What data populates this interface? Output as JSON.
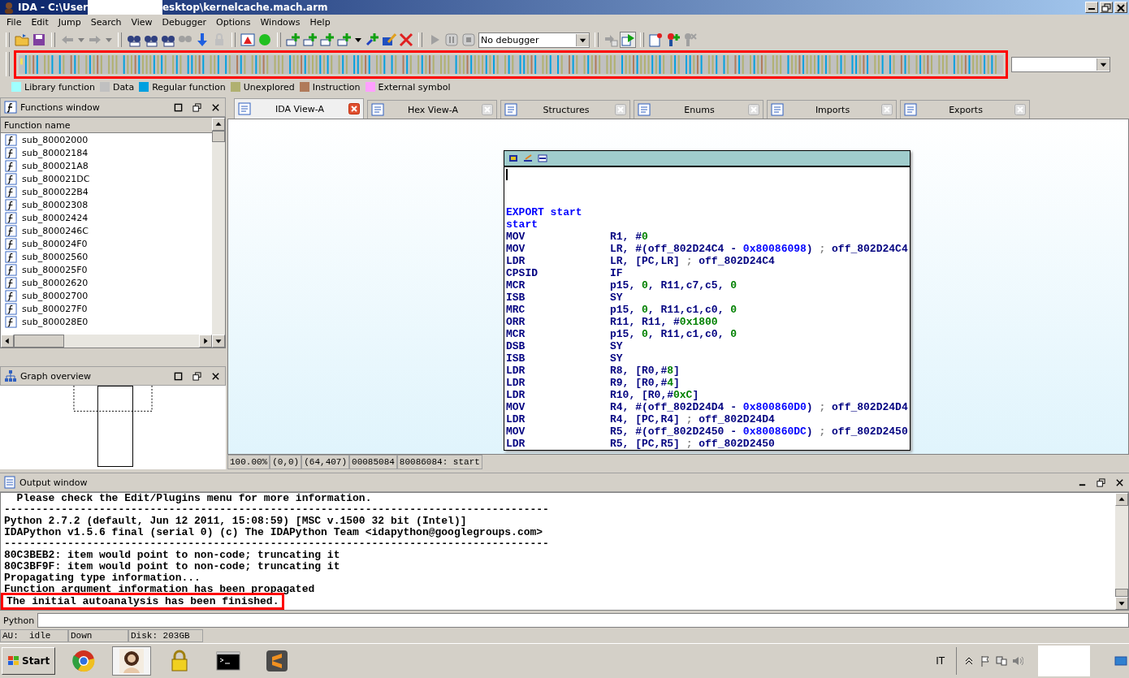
{
  "window": {
    "title_before": "IDA - C:\\User",
    "title_after": "esktop\\kernelcache.mach.arm"
  },
  "menu": [
    "File",
    "Edit",
    "Jump",
    "Search",
    "View",
    "Debugger",
    "Options",
    "Windows",
    "Help"
  ],
  "debugger_select": {
    "value": "No debugger"
  },
  "navigation_band": {
    "highlighted": true
  },
  "legend": [
    {
      "label": "Library function",
      "color": "#a0ffff"
    },
    {
      "label": "Data",
      "color": "#c0c0c0"
    },
    {
      "label": "Regular function",
      "color": "#00a0e0"
    },
    {
      "label": "Unexplored",
      "color": "#b0b070"
    },
    {
      "label": "Instruction",
      "color": "#b07a5a"
    },
    {
      "label": "External symbol",
      "color": "#ffa0ff"
    }
  ],
  "functions_window": {
    "title": "Functions window",
    "column": "Function name",
    "rows": [
      "sub_80002000",
      "sub_80002184",
      "sub_800021A8",
      "sub_800021DC",
      "sub_800022B4",
      "sub_80002308",
      "sub_80002424",
      "sub_8000246C",
      "sub_800024F0",
      "sub_80002560",
      "sub_800025F0",
      "sub_80002620",
      "sub_80002700",
      "sub_800027F0",
      "sub_800028E0"
    ]
  },
  "graph_overview": {
    "title": "Graph overview"
  },
  "tabs": [
    {
      "label": "IDA View-A",
      "selected": true
    },
    {
      "label": "Hex View-A",
      "selected": false
    },
    {
      "label": "Structures",
      "selected": false
    },
    {
      "label": "Enums",
      "selected": false
    },
    {
      "label": "Imports",
      "selected": false
    },
    {
      "label": "Exports",
      "selected": false
    }
  ],
  "disassembly": [
    {
      "kind": "label",
      "text": "EXPORT start"
    },
    {
      "kind": "label",
      "text": "start"
    },
    {
      "kind": "insn",
      "mnemonic": "MOV",
      "operands": [
        {
          "kind": "reg",
          "text": "R1, #"
        },
        {
          "kind": "num",
          "text": "0"
        }
      ]
    },
    {
      "kind": "insn",
      "mnemonic": "MOV",
      "operands": [
        {
          "kind": "reg",
          "text": "LR, #(off_802D24C4 - "
        },
        {
          "kind": "addr",
          "text": "0x80086098"
        },
        {
          "kind": "reg",
          "text": ") "
        },
        {
          "kind": "cmt",
          "text": "; "
        },
        {
          "kind": "reg",
          "text": "off_802D24C4"
        }
      ]
    },
    {
      "kind": "insn",
      "mnemonic": "LDR",
      "operands": [
        {
          "kind": "reg",
          "text": "LR, [PC,LR] "
        },
        {
          "kind": "cmt",
          "text": "; "
        },
        {
          "kind": "reg",
          "text": "off_802D24C4"
        }
      ]
    },
    {
      "kind": "insn",
      "mnemonic": "CPSID",
      "operands": [
        {
          "kind": "reg",
          "text": "IF"
        }
      ]
    },
    {
      "kind": "insn",
      "mnemonic": "MCR",
      "operands": [
        {
          "kind": "reg",
          "text": "p15, "
        },
        {
          "kind": "num",
          "text": "0"
        },
        {
          "kind": "reg",
          "text": ", R11,c7,c5, "
        },
        {
          "kind": "num",
          "text": "0"
        }
      ]
    },
    {
      "kind": "insn",
      "mnemonic": "ISB",
      "operands": [
        {
          "kind": "reg",
          "text": "SY"
        }
      ]
    },
    {
      "kind": "insn",
      "mnemonic": "MRC",
      "operands": [
        {
          "kind": "reg",
          "text": "p15, "
        },
        {
          "kind": "num",
          "text": "0"
        },
        {
          "kind": "reg",
          "text": ", R11,c1,c0, "
        },
        {
          "kind": "num",
          "text": "0"
        }
      ]
    },
    {
      "kind": "insn",
      "mnemonic": "ORR",
      "operands": [
        {
          "kind": "reg",
          "text": "R11, R11, #"
        },
        {
          "kind": "num",
          "text": "0x1800"
        }
      ]
    },
    {
      "kind": "insn",
      "mnemonic": "MCR",
      "operands": [
        {
          "kind": "reg",
          "text": "p15, "
        },
        {
          "kind": "num",
          "text": "0"
        },
        {
          "kind": "reg",
          "text": ", R11,c1,c0, "
        },
        {
          "kind": "num",
          "text": "0"
        }
      ]
    },
    {
      "kind": "insn",
      "mnemonic": "DSB",
      "operands": [
        {
          "kind": "reg",
          "text": "SY"
        }
      ]
    },
    {
      "kind": "insn",
      "mnemonic": "ISB",
      "operands": [
        {
          "kind": "reg",
          "text": "SY"
        }
      ]
    },
    {
      "kind": "insn",
      "mnemonic": "LDR",
      "operands": [
        {
          "kind": "reg",
          "text": "R8, [R0,#"
        },
        {
          "kind": "num",
          "text": "8"
        },
        {
          "kind": "reg",
          "text": "]"
        }
      ]
    },
    {
      "kind": "insn",
      "mnemonic": "LDR",
      "operands": [
        {
          "kind": "reg",
          "text": "R9, [R0,#"
        },
        {
          "kind": "num",
          "text": "4"
        },
        {
          "kind": "reg",
          "text": "]"
        }
      ]
    },
    {
      "kind": "insn",
      "mnemonic": "LDR",
      "operands": [
        {
          "kind": "reg",
          "text": "R10, [R0,#"
        },
        {
          "kind": "num",
          "text": "0xC"
        },
        {
          "kind": "reg",
          "text": "]"
        }
      ]
    },
    {
      "kind": "insn",
      "mnemonic": "MOV",
      "operands": [
        {
          "kind": "reg",
          "text": "R4, #(off_802D24D4 - "
        },
        {
          "kind": "addr",
          "text": "0x800860D0"
        },
        {
          "kind": "reg",
          "text": ") "
        },
        {
          "kind": "cmt",
          "text": "; "
        },
        {
          "kind": "reg",
          "text": "off_802D24D4"
        }
      ]
    },
    {
      "kind": "insn",
      "mnemonic": "LDR",
      "operands": [
        {
          "kind": "reg",
          "text": "R4, [PC,R4] "
        },
        {
          "kind": "cmt",
          "text": "; "
        },
        {
          "kind": "reg",
          "text": "off_802D24D4"
        }
      ]
    },
    {
      "kind": "insn",
      "mnemonic": "MOV",
      "operands": [
        {
          "kind": "reg",
          "text": "R5, #(off_802D2450 - "
        },
        {
          "kind": "addr",
          "text": "0x800860DC"
        },
        {
          "kind": "reg",
          "text": ") "
        },
        {
          "kind": "cmt",
          "text": "; "
        },
        {
          "kind": "reg",
          "text": "off_802D2450"
        }
      ]
    },
    {
      "kind": "insn",
      "mnemonic": "LDR",
      "operands": [
        {
          "kind": "reg",
          "text": "R5, [PC,R5] "
        },
        {
          "kind": "cmt",
          "text": "; "
        },
        {
          "kind": "reg",
          "text": "off_802D2450"
        }
      ]
    }
  ],
  "view_status": [
    "100.00%",
    "(0,0)",
    "(64,407)",
    "00085084",
    "80086084: start"
  ],
  "output_window": {
    "title": "Output window",
    "lines": [
      {
        "text": "  Please check the Edit/Plugins menu for more information.",
        "highlighted": false
      },
      {
        "text": "--------------------------------------------------------------------------------------",
        "highlighted": false
      },
      {
        "text": "Python 2.7.2 (default, Jun 12 2011, 15:08:59) [MSC v.1500 32 bit (Intel)]",
        "highlighted": false
      },
      {
        "text": "IDAPython v1.5.6 final (serial 0) (c) The IDAPython Team <idapython@googlegroups.com>",
        "highlighted": false
      },
      {
        "text": "--------------------------------------------------------------------------------------",
        "highlighted": false
      },
      {
        "text": "80C3BEB2: item would point to non-code; truncating it",
        "highlighted": false
      },
      {
        "text": "80C3BF9F: item would point to non-code; truncating it",
        "highlighted": false
      },
      {
        "text": "Propagating type information...",
        "highlighted": false
      },
      {
        "text": "Function argument information has been propagated",
        "highlighted": false
      },
      {
        "text": "The initial autoanalysis has been finished.",
        "highlighted": true
      }
    ]
  },
  "python_bar": {
    "label": "Python"
  },
  "status_bar": [
    "AU:  idle",
    "Down",
    "Disk: 203GB"
  ],
  "taskbar": {
    "start": "Start",
    "language": "IT"
  }
}
